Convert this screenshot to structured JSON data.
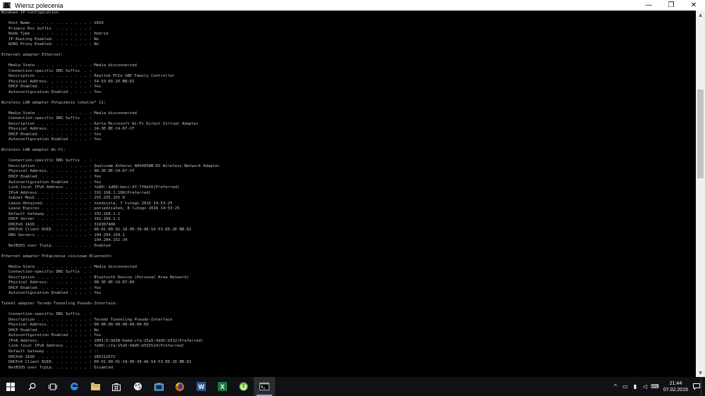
{
  "window": {
    "title": "Wiersz polecenia",
    "icon_text": "C:\\",
    "controls": {
      "minimize": "—",
      "maximize": "❐",
      "close": "✕"
    }
  },
  "console": {
    "lines": [
      "Windows IP Configuration",
      "",
      "   Host Name . . . . . . . . . . . . : VAIO",
      "   Primary Dns Suffix  . . . . . . . :",
      "   Node Type . . . . . . . . . . . . : Hybrid",
      "   IP Routing Enabled. . . . . . . . : No",
      "   WINS Proxy Enabled. . . . . . . . : No",
      "",
      "Ethernet adapter Ethernet:",
      "",
      "   Media State . . . . . . . . . . . : Media disconnected",
      "   Connection-specific DNS Suffix  . :",
      "   Description . . . . . . . . . . . : Realtek PCIe GBE Family Controller",
      "   Physical Address. . . . . . . . . : 54-53-ED-2E-BB-D2",
      "   DHCP Enabled. . . . . . . . . . . : Yes",
      "   Autoconfiguration Enabled . . . . : Yes",
      "",
      "Wireless LAN adapter Połączenie lokalne* 11:",
      "",
      "   Media State . . . . . . . . . . . : Media disconnected",
      "   Connection-specific DNS Suffix  . :",
      "   Description . . . . . . . . . . . : Karta Microsoft Wi-Fi Direct Virtual Adapter",
      "   Physical Address. . . . . . . . . : 1A-3E-BE-CA-D7-CF",
      "   DHCP Enabled. . . . . . . . . . . : Yes",
      "   Autoconfiguration Enabled . . . . : Yes",
      "",
      "Wireless LAN adapter Wi-Fi:",
      "",
      "   Connection-specific DNS Suffix  . :",
      "   Description . . . . . . . . . . . : Qualcomm Atheros AR9485WB-EG Wireless Network Adapter",
      "   Physical Address. . . . . . . . . : 08-3E-8E-CA-D7-CF",
      "   DHCP Enabled. . . . . . . . . . . : Yes",
      "   Autoconfiguration Enabled . . . . : Yes",
      "   Link-local IPv6 Address . . . . . : fe80::1d80:becc:47:7f0e%5(Preferred)",
      "   IPv4 Address. . . . . . . . . . . : 192.168.1.100(Preferred)",
      "   Subnet Mask . . . . . . . . . . . : 255.255.255.0",
      "   Lease Obtained. . . . . . . . . . : niedziela, 7 lutego 2016 14:53:25",
      "   Lease Expires . . . . . . . . . . : poniedziałek, 8 lutego 2016 14:53:25",
      "   Default Gateway . . . . . . . . . : 192.168.1.1",
      "   DHCP Server . . . . . . . . . . . : 192.168.1.1",
      "   DHCPv6 IAID . . . . . . . . . . . : 319307406",
      "   DHCPv6 Client DUID. . . . . . . . : 00-01-00-01-18-0E-39-A6-54-53-ED-2E-BB-D2",
      "   DNS Servers . . . . . . . . . . . : 194.204.159.1",
      "                                       194.204.152.34",
      "   NetBIOS over Tcpip. . . . . . . . : Enabled",
      "",
      "Ethernet adapter Połączenie sieciowe Bluetooth:",
      "",
      "   Media State . . . . . . . . . . . : Media disconnected",
      "   Connection-specific DNS Suffix  . :",
      "   Description . . . . . . . . . . . : Bluetooth Device (Personal Area Network)",
      "   Physical Address. . . . . . . . . : 08-3E-8E-CA-D7-D0",
      "   DHCP Enabled. . . . . . . . . . . : Yes",
      "   Autoconfiguration Enabled . . . . : Yes",
      "",
      "Tunnel adapter Teredo Tunneling Pseudo-Interface:",
      "",
      "   Connection-specific DNS Suffix  . :",
      "   Description . . . . . . . . . . . : Teredo Tunneling Pseudo-Interface",
      "   Physical Address. . . . . . . . . : 00-00-00-00-00-00-00-E0",
      "   DHCP Enabled. . . . . . . . . . . : No",
      "   Autoconfiguration Enabled . . . . : Yes",
      "   IPv6 Address. . . . . . . . . . . : 2001:0:9d38:6abd:cfa:15a5:4dd5:b532(Preferred)",
      "   Link-local IPv6 Address . . . . . : fe80::cfa:15a5:4dd5:b532%14(Preferred)",
      "   Default Gateway . . . . . . . . . : ::",
      "   DHCPv6 IAID . . . . . . . . . . . : 285212672",
      "   DHCPv6 Client DUID. . . . . . . . : 00-01-00-01-18-0E-39-A6-54-53-ED-2E-BB-D2",
      "   NetBIOS over Tcpip. . . . . . . . : Disabled"
    ]
  },
  "scrollbar": {
    "up": "▲",
    "down": "▼",
    "position": 0.22
  },
  "taskbar": {
    "items": [
      {
        "name": "search",
        "icon": "search-icon",
        "active": false
      },
      {
        "name": "task-view",
        "icon": "task-view-icon",
        "active": false
      },
      {
        "name": "edge",
        "icon": "edge-icon",
        "active": false
      },
      {
        "name": "file-explorer",
        "icon": "folder-icon",
        "active": false
      },
      {
        "name": "store",
        "icon": "store-icon",
        "active": false
      },
      {
        "name": "paint",
        "icon": "paint-icon",
        "active": false
      },
      {
        "name": "media",
        "icon": "media-icon",
        "active": false
      },
      {
        "name": "firefox",
        "icon": "firefox-icon",
        "active": false
      },
      {
        "name": "word",
        "icon": "word-icon",
        "active": false
      },
      {
        "name": "excel",
        "icon": "excel-icon",
        "active": false
      },
      {
        "name": "utorrent",
        "icon": "utorrent-icon",
        "active": false
      },
      {
        "name": "command-prompt",
        "icon": "cmd-icon",
        "active": true
      }
    ],
    "word_letter": "W",
    "excel_letter": "X",
    "tray_symbols": {
      "chevron": "^",
      "display": "▭",
      "network": "▮",
      "volume": "◁",
      "input": "⌨"
    },
    "time": "21:44",
    "date": "07.02.2016"
  },
  "colors": {
    "console_text": "#c0c0c0",
    "console_bg": "#000000",
    "taskbar_bg": "#0f1114",
    "accent": "#7aa7d8"
  }
}
